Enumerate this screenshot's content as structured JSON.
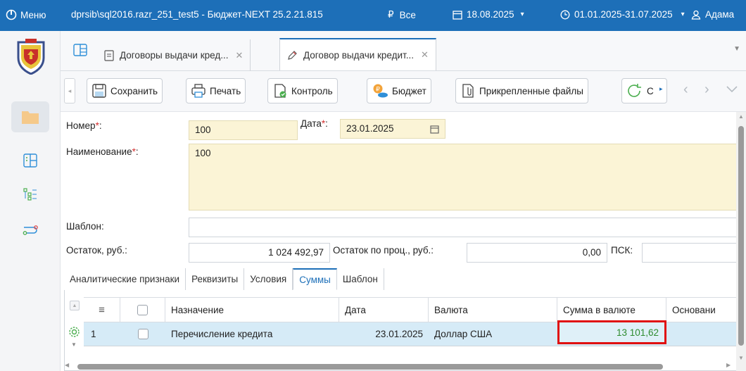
{
  "topbar": {
    "menu_label": "Меню",
    "path_title": "dprsib\\sql2016.razr_251_test5 - Бюджет-NEXT 25.2.21.815",
    "filter_label": "Все",
    "date": "18.08.2025",
    "period": "01.01.2025-31.07.2025",
    "user": "Адама"
  },
  "tabs": [
    {
      "label": "Договоры выдачи кред..."
    },
    {
      "label": "Договор выдачи кредит..."
    }
  ],
  "toolbar": {
    "save": "Сохранить",
    "print": "Печать",
    "control": "Контроль",
    "budget": "Бюджет",
    "files": "Прикрепленные файлы",
    "more": "С"
  },
  "form": {
    "number_label": "Номер",
    "number_value": "100",
    "date_label": "Дата",
    "date_value": "23.01.2025",
    "name_label": "Наименование",
    "name_value": "100",
    "template_label": "Шаблон:",
    "template_value": "",
    "balance_label": "Остаток, руб.:",
    "balance_value": "1 024 492,97",
    "interest_label": "Остаток по проц., руб.:",
    "interest_value": "0,00",
    "psk_label": "ПСК:",
    "psk_value": ""
  },
  "subtabs": [
    "Аналитические признаки",
    "Реквизиты",
    "Условия",
    "Суммы",
    "Шаблон"
  ],
  "grid": {
    "columns": [
      "Назначение",
      "Дата",
      "Валюта",
      "Сумма в валюте",
      "Основани"
    ],
    "rows": [
      {
        "num": "1",
        "purpose": "Перечисление кредита",
        "date": "23.01.2025",
        "currency": "Доллар США",
        "amount": "13 101,62",
        "basis": ""
      }
    ]
  },
  "colors": {
    "accent": "#1d6fb8",
    "highlight_border": "#e01010",
    "amount_text": "#2e8b2e"
  }
}
